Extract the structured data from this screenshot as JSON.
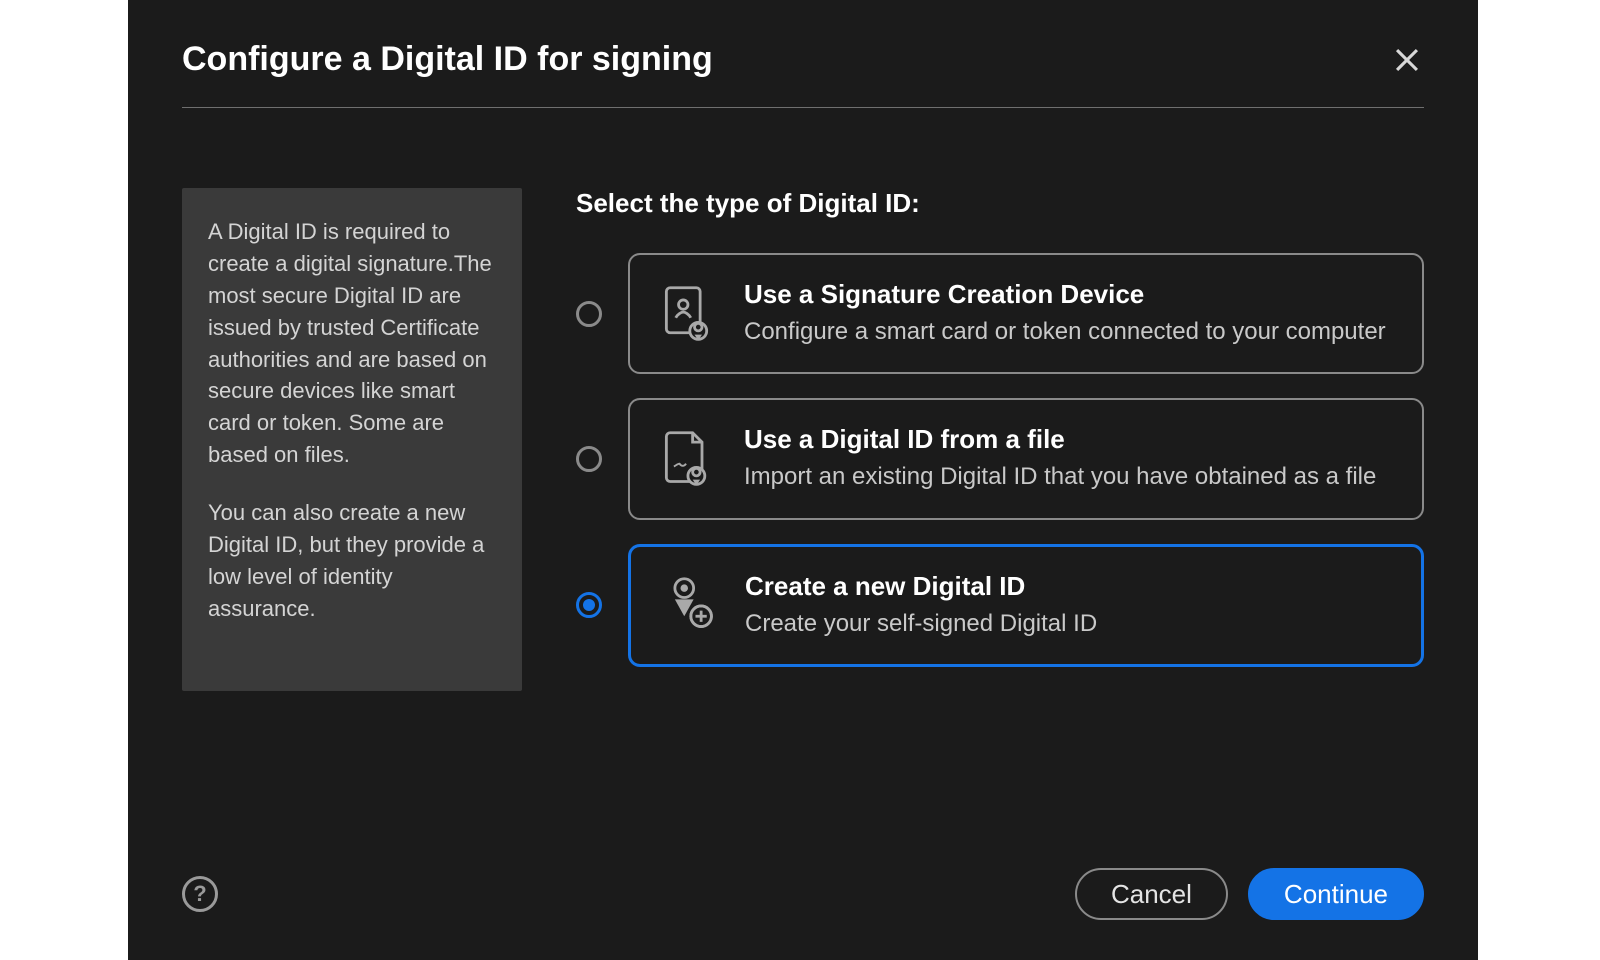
{
  "dialog": {
    "title": "Configure a Digital ID for signing",
    "info_paragraph_1": "A Digital ID is required to create a digital signature.The most secure Digital ID are issued by trusted Certificate authorities and are based on secure devices like smart card or token. Some are based on files.",
    "info_paragraph_2": "You can also create a new Digital ID, but they provide a low level of identity assurance.",
    "select_prompt": "Select the type of Digital ID:",
    "options": [
      {
        "id": "signature-device",
        "title": "Use a Signature Creation Device",
        "desc": "Configure a smart card or token connected to your computer",
        "selected": false
      },
      {
        "id": "from-file",
        "title": "Use a Digital ID from a file",
        "desc": "Import an existing Digital ID that you have obtained as a file",
        "selected": false
      },
      {
        "id": "create-new",
        "title": "Create a new Digital ID",
        "desc": "Create your self-signed Digital ID",
        "selected": true
      }
    ],
    "help_label": "?",
    "cancel_label": "Cancel",
    "continue_label": "Continue"
  }
}
